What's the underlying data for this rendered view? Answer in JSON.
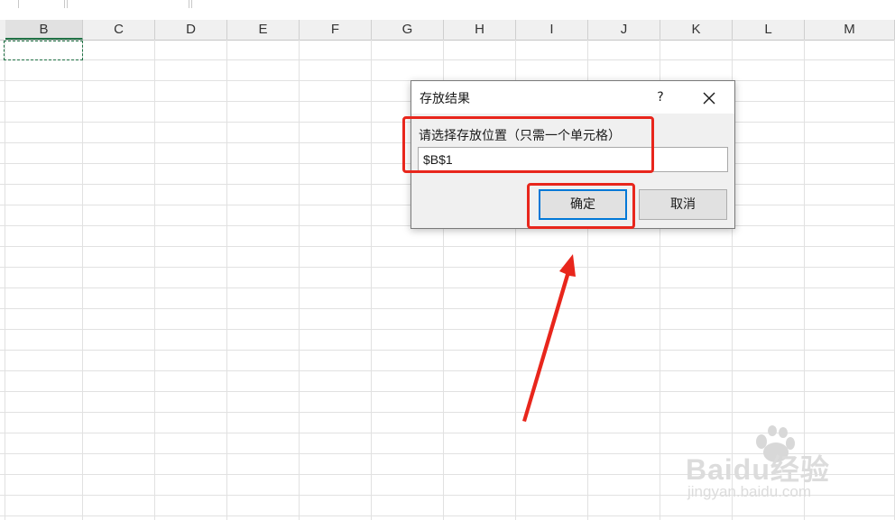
{
  "spreadsheet": {
    "columns": [
      "B",
      "C",
      "D",
      "E",
      "F",
      "G",
      "H",
      "I",
      "J",
      "K",
      "L",
      "M"
    ],
    "selected_column": "B"
  },
  "dialog": {
    "title": "存放结果",
    "help_label": "?",
    "prompt": "请选择存放位置（只需一个单元格）",
    "input_value": "$B$1",
    "ok_label": "确定",
    "cancel_label": "取消"
  },
  "watermark": {
    "brand": "Baidu经验",
    "url": "jingyan.baidu.com"
  },
  "colors": {
    "highlight": "#e8261c",
    "default_button_border": "#0078d7",
    "selection": "#217346"
  },
  "icons": [
    "close-icon",
    "help-icon",
    "annotation-arrow"
  ]
}
